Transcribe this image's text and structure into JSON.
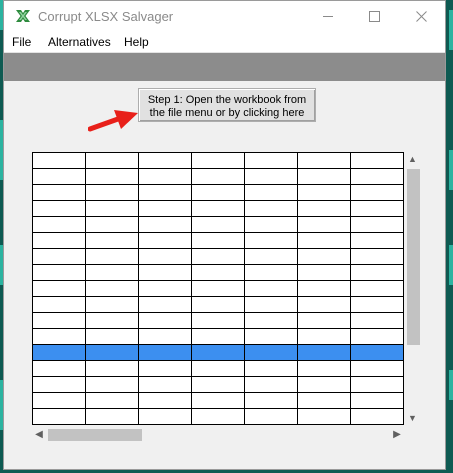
{
  "window": {
    "title": "Corrupt XLSX Salvager"
  },
  "menu": {
    "file": "File",
    "alternatives": "Alternatives",
    "help": "Help"
  },
  "step_button": {
    "line1": "Step 1: Open the workbook from",
    "line2": "the file menu or by clicking here"
  },
  "colors": {
    "accent_selected_row": "#3c8ff0",
    "arrow": "#e8201a",
    "toolbar_band": "#8c8c8c"
  },
  "icons": {
    "app": "excel-x-icon",
    "arrow": "red-arrow-icon"
  },
  "grid": {
    "selected_row_index": 12
  }
}
